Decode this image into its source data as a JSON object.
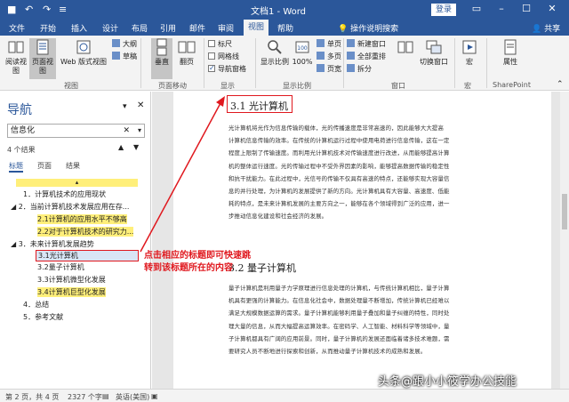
{
  "window": {
    "title": "文档1 - Word",
    "login_label": "登录",
    "qa_save": "■",
    "qa_undo": "↶",
    "qa_redo": "↷",
    "qa_custom": "≡"
  },
  "tabs": {
    "items": [
      "文件",
      "开始",
      "插入",
      "设计",
      "布局",
      "引用",
      "邮件",
      "审阅",
      "视图",
      "帮助"
    ],
    "active": "视图",
    "tell_me": "操作说明搜索",
    "share": "共享"
  },
  "ribbon": {
    "views": {
      "read_mode": "阅读视图",
      "print_layout": "页面视图",
      "web_layout": "Web 版式视图",
      "outline": "大纲",
      "draft": "草稿",
      "group": "视图"
    },
    "page_move": {
      "vertical": "垂直",
      "side": "翻页",
      "group": "页面移动"
    },
    "show": {
      "ruler": "标尺",
      "gridlines": "网格线",
      "nav_pane": "导航窗格",
      "group": "显示"
    },
    "zoom": {
      "zoom": "显示比例",
      "hundred": "100%",
      "one_page": "单页",
      "multi_page": "多页",
      "page_width": "页宽",
      "group": "显示比例"
    },
    "window": {
      "new_window": "新建窗口",
      "arrange_all": "全部重排",
      "split": "拆分",
      "switch": "切换窗口",
      "group": "窗口"
    },
    "macros": {
      "label": "宏",
      "group": "宏"
    },
    "sharepoint": {
      "label": "属性",
      "group": "SharePoint"
    }
  },
  "nav": {
    "title": "导航",
    "search_value": "信息化",
    "result_count": "4 个结果",
    "tabs": [
      "标题",
      "页面",
      "结果"
    ],
    "headings": [
      "1．计算机技术的应用现状",
      "2．当前计算机技术发展应用在存...",
      "2.1计算机的应用水平不够高",
      "2.2对于计算机技术的研究力...",
      "3．未来计算机发展趋势",
      "3.1光计算机",
      "3.2量子计算机",
      "3.3计算机微型化发展",
      "3.4计算机巨型化发展",
      "4．总结",
      "5．参考文献"
    ]
  },
  "annotation": "点击相应的标题即可快速跳转到该标题所在的内容",
  "document": {
    "heading1": "3.1 光计算机",
    "para1": [
      "光计算机将光作为信息传输的载体，光的传播速度是非常高速的，因此能够大大提高",
      "计算机信息传输的效率。在传统的计算机运行过程中使用电荷进行信息传输，这在一定",
      "程度上限制了传输速度。而利用光计算机技术对传输速度进行改进，从而能够提高计算",
      "机的整体运行速度。光的传输过程中不受外界因素的影响，能够提高数据传输的稳定性",
      "和抗干扰能力。在此过程中，光信号的传输不仅具有高速的特点，还能够实现大容量信",
      "息的并行处理，为计算机的发展提供了新的方向。光计算机具有大容量、高速度、低能",
      "耗的特点，是未来计算机发展的主要方向之一，能够在各个领域得到广泛的应用，进一",
      "步推动信息化建设和社会经济的发展。"
    ],
    "heading2": "3.2 量子计算机",
    "para2": [
      "量子计算机是利用量子力学原理进行信息处理的计算机，与传统计算机相比，量子计算",
      "机具有更强的计算能力。在信息化社会中，数据处理量不断增加，传统计算机已经难以",
      "满足大规模数据运算的需求。量子计算机能够利用量子叠加和量子纠缠的特性，同时处",
      "理大量的信息，从而大幅提高运算效率。在密码学、人工智能、材料科学等领域中，量",
      "子计算机都具有广阔的应用前景。同时，量子计算机的发展还面临着诸多技术难题，需",
      "要研究人员不断地进行探索和创新，从而推动量子计算机技术的成熟和发展。"
    ]
  },
  "status": {
    "page": "第 2 页，共 4 页",
    "words": "2327 个字",
    "lang": "英语(美国)"
  },
  "watermark": "头条@跟小小筱学办公技能",
  "colors": {
    "word_blue": "#2b579a",
    "highlight": "#ffef7a",
    "annotation_red": "#e0181e"
  }
}
